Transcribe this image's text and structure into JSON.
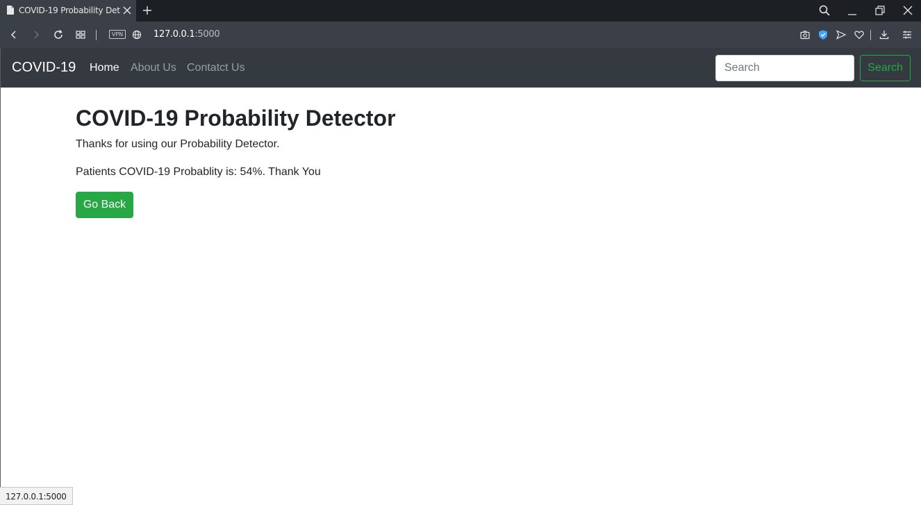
{
  "browser": {
    "tab_title": "COVID-19 Probability Dete",
    "url_host": "127.0.0.1",
    "url_port": ":5000",
    "vpn_label": "VPN",
    "status_url": "127.0.0.1:5000"
  },
  "navbar": {
    "brand": "COVID-19",
    "links": [
      {
        "label": "Home",
        "active": true
      },
      {
        "label": "About Us",
        "active": false
      },
      {
        "label": "Contatct Us",
        "active": false
      }
    ],
    "search_placeholder": "Search",
    "search_button": "Search"
  },
  "main": {
    "title": "COVID-19 Probability Detector",
    "lead": "Thanks for using our Probability Detector.",
    "result": "Patients COVID-19 Probablity is: 54%. Thank You",
    "back_button": "Go Back"
  },
  "colors": {
    "navbar_bg": "#343a40",
    "success": "#28a745",
    "browser_chrome": "#3b4048"
  }
}
